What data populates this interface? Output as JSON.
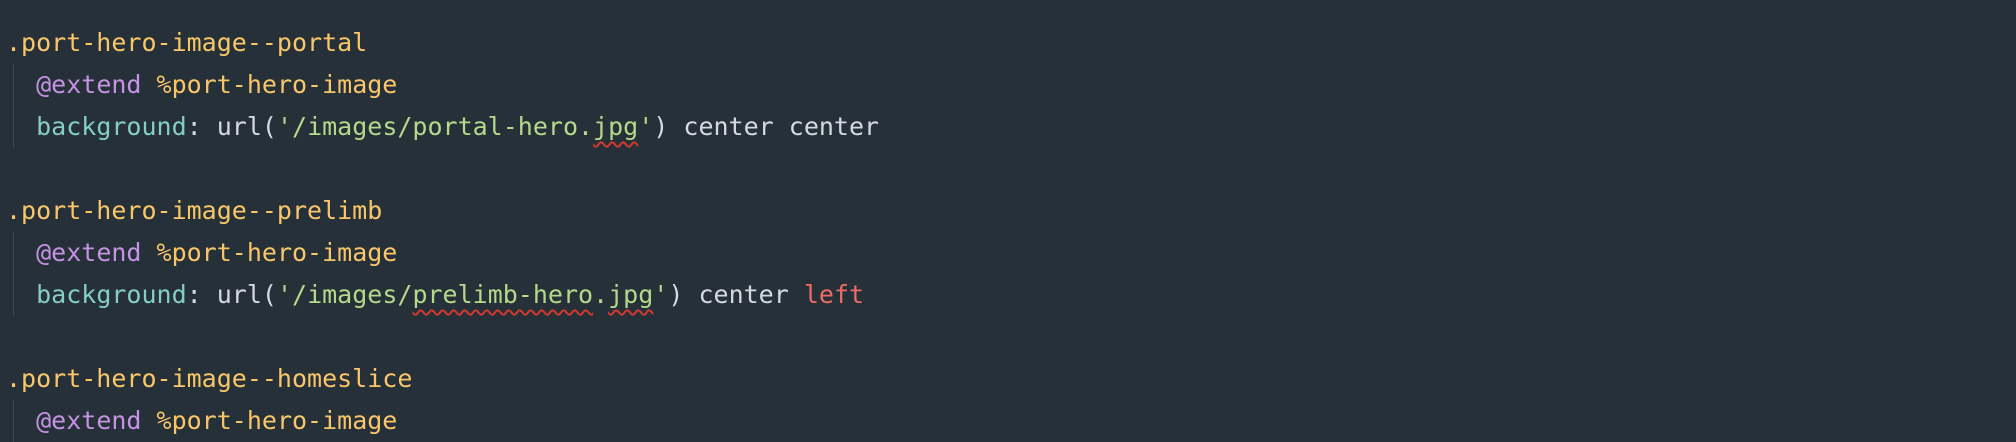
{
  "editor": {
    "theme_colors": {
      "background": "#263038",
      "selector": "#f9c66a",
      "at_rule": "#c592e4",
      "property": "#84cfc5",
      "string": "#b5d98a",
      "plain": "#d3dbe2",
      "invalid_value": "#ef6b67",
      "spellcheck_underline": "#d1392f"
    },
    "lines": [
      {
        "selector": ".port-hero-image--portal"
      },
      {
        "at_rule": "@extend",
        "placeholder": "%port-hero-image"
      },
      {
        "property": "background",
        "colon": ":",
        "func_open": "url(",
        "string_pre": "'/images/portal-hero.",
        "string_misspelled": "jpg",
        "string_post": "'",
        "func_close": ")",
        "value1": "center",
        "value2": "center"
      },
      {},
      {
        "selector": ".port-hero-image--prelimb"
      },
      {
        "at_rule": "@extend",
        "placeholder": "%port-hero-image"
      },
      {
        "property": "background",
        "colon": ":",
        "func_open": "url(",
        "string_pre": "'/images/",
        "string_misspelled_1": "prelimb-hero",
        "string_mid": ".",
        "string_misspelled_2": "jpg",
        "string_post": "'",
        "func_close": ")",
        "value1": "center",
        "value2": "left"
      },
      {},
      {
        "selector": ".port-hero-image--homeslice"
      },
      {
        "at_rule": "@extend",
        "placeholder": "%port-hero-image"
      }
    ]
  }
}
